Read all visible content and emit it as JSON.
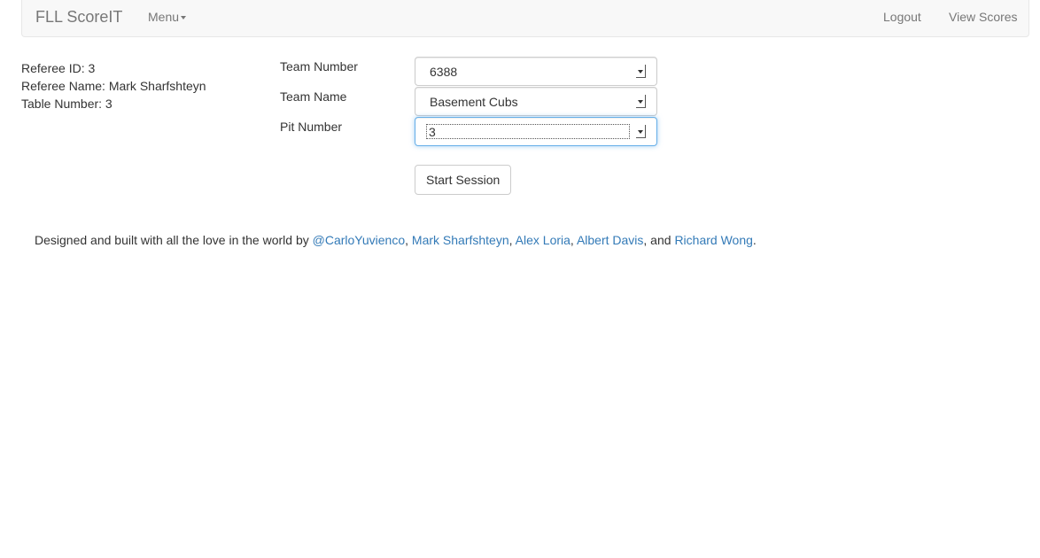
{
  "navbar": {
    "brand": "FLL ScoreIT",
    "menu_label": "Menu",
    "logout_label": "Logout",
    "view_scores_label": "View Scores"
  },
  "referee": {
    "id_line": "Referee ID: 3",
    "name_line": "Referee Name: Mark Sharfshteyn",
    "table_line": "Table Number: 3"
  },
  "form": {
    "team_number_label": "Team Number",
    "team_number_value": "6388",
    "team_name_label": "Team Name",
    "team_name_value": "Basement Cubs",
    "pit_number_label": "Pit Number",
    "pit_number_value": "3",
    "start_button_label": "Start Session"
  },
  "footer": {
    "intro": "Designed and built with all the love in the world by ",
    "credits": [
      "@CarloYuvienco",
      "Mark Sharfshteyn",
      "Alex Loria",
      "Albert Davis",
      "Richard Wong"
    ],
    "sep1": ", ",
    "sep2": ", ",
    "sep3": ", ",
    "sep4": ", and ",
    "end": "."
  },
  "colors": {
    "link": "#337ab7",
    "navbar_bg": "#f8f8f8",
    "focus_border": "#66afe9"
  }
}
